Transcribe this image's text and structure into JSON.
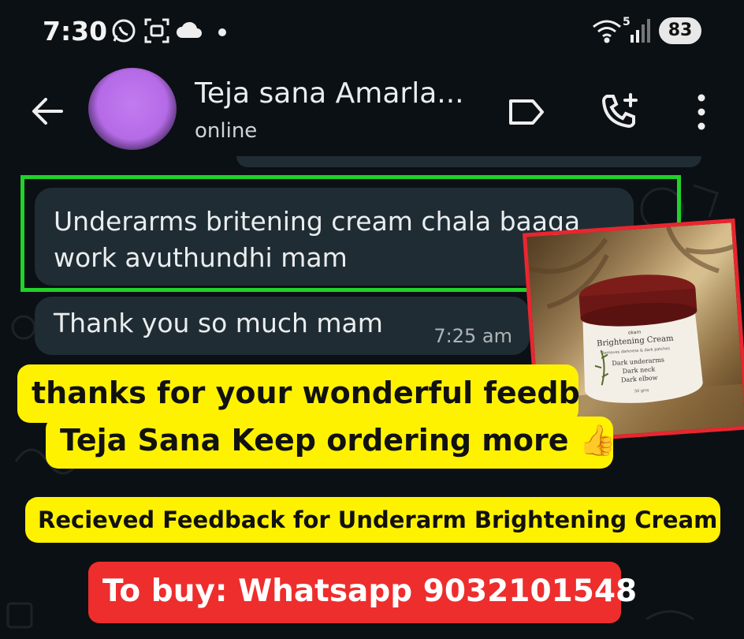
{
  "status_bar": {
    "time": "7:30",
    "battery": "83",
    "network_label": "5"
  },
  "header": {
    "contact_name": "Teja sana Amarla...",
    "contact_status": "online"
  },
  "messages": [
    {
      "text": "Underarms britening cream chala baaga work avuthundhi mam",
      "time": ""
    },
    {
      "text": "Thank you so much mam",
      "time": "7:25 am"
    }
  ],
  "product": {
    "label_title": "Brightening Cream",
    "label_subtitle": "Removes darkness & dark patches",
    "label_lines": [
      "Dark underarms",
      "Dark neck",
      "Dark elbow"
    ],
    "label_weight": "50 gms"
  },
  "callouts": {
    "thanks_line1": "thanks for your wonderful feedb",
    "thanks_line2": "Teja Sana Keep ordering more 👍",
    "feedback": "Recieved Feedback for Underarm Brightening Cream",
    "buy": "To buy: Whatsapp 9032101548"
  },
  "colors": {
    "background": "#0b1014",
    "bubble": "#202c33",
    "highlight": "#22d12a",
    "callout_yellow": "#fff200",
    "buy_red": "#ee2d2d"
  }
}
